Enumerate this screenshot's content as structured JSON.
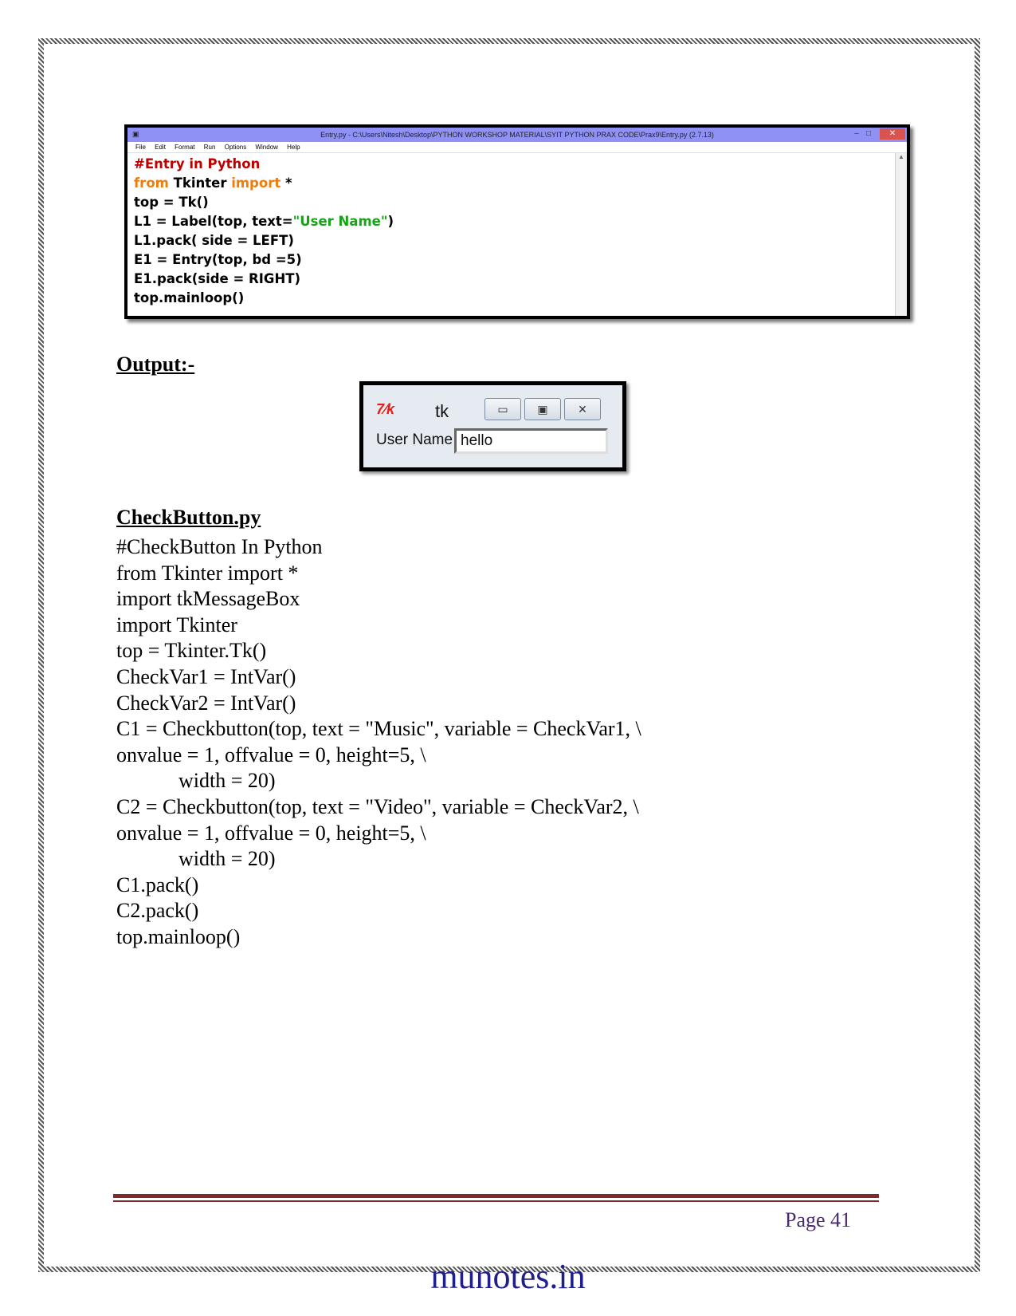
{
  "idle_window": {
    "title": "Entry.py - C:\\Users\\Nitesh\\Desktop\\PYTHON WORKSHOP MATERIAL\\SYIT PYTHON PRAX CODE\\Prax9\\Entry.py (2.7.13)",
    "menu": [
      "File",
      "Edit",
      "Format",
      "Run",
      "Options",
      "Window",
      "Help"
    ],
    "code": {
      "line1": "#Entry in Python",
      "line2_kw1": "from",
      "line2_mid": " Tkinter ",
      "line2_kw2": "import",
      "line2_end": " *",
      "line3": "top = Tk()",
      "line4_pre": "L1 = Label(top, text=",
      "line4_str": "\"User Name\"",
      "line4_end": ")",
      "line5": "L1.pack( side = LEFT)",
      "line6": "E1 = Entry(top, bd =5)",
      "line7": "E1.pack(side = RIGHT)",
      "line8": "top.mainloop()"
    }
  },
  "output_heading": "Output:-",
  "tk_window": {
    "title": "tk",
    "label": "User Name",
    "entry_value": "hello"
  },
  "checkbutton_heading": "CheckButton.py",
  "checkbutton_code": [
    "#CheckButton In Python",
    "from Tkinter import *",
    "import tkMessageBox",
    "import Tkinter",
    "top = Tkinter.Tk()",
    "CheckVar1 = IntVar()",
    "CheckVar2 = IntVar()",
    "C1 = Checkbutton(top, text = \"Music\", variable = CheckVar1, \\",
    "onvalue = 1, offvalue = 0, height=5, \\",
    "            width = 20)",
    "C2 = Checkbutton(top, text = \"Video\", variable = CheckVar2, \\",
    "onvalue = 1, offvalue = 0, height=5, \\",
    "            width = 20)",
    "C1.pack()",
    "C2.pack()",
    "top.mainloop()"
  ],
  "footer": {
    "page": "Page 41",
    "site": "munotes.in"
  }
}
